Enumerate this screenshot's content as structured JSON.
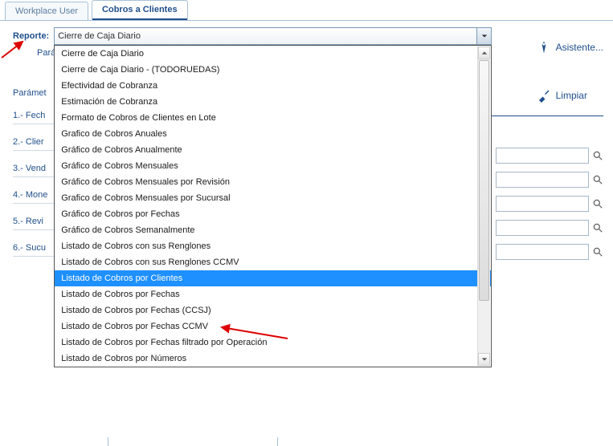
{
  "tabs": {
    "workplace": "Workplace User",
    "active": "Cobros a Clientes"
  },
  "report_label": "Reporte:",
  "select_value": "Cierre de Caja Diario",
  "second_label": "Pará",
  "dropdown_items": [
    "Cierre de Caja Diario",
    "Cierre de Caja Diario - (TODORUEDAS)",
    "Efectividad de Cobranza",
    "Estimación de Cobranza",
    "Formato de Cobros de Clientes en Lote",
    "Grafico de Cobros Anuales",
    "Gráfico de Cobros Anualmente",
    "Gráfico de Cobros Mensuales",
    "Gráfico de Cobros Mensuales por Revisión",
    "Grafico de Cobros Mensuales por Sucursal",
    "Gráfico de Cobros por Fechas",
    "Gráfico de Cobros Semanalmente",
    "Listado de Cobros con sus Renglones",
    "Listado de Cobros con sus Renglones CCMV",
    "Listado de Cobros por Clientes",
    "Listado de Cobros por Fechas",
    "Listado de Cobros por Fechas (CCSJ)",
    "Listado de Cobros por Fechas CCMV",
    "Listado de Cobros por Fechas filtrado por Operación",
    "Listado de Cobros por Números"
  ],
  "selected_index": 14,
  "actions": {
    "asistente": "Asistente...",
    "limpiar": "Limpiar"
  },
  "params_title": "Parámet",
  "params": [
    "1.- Fech",
    "2.- Clier",
    "3.- Vend",
    "4.- Mone",
    "5.- Revi",
    "6.- Sucu"
  ],
  "search_count": 5
}
